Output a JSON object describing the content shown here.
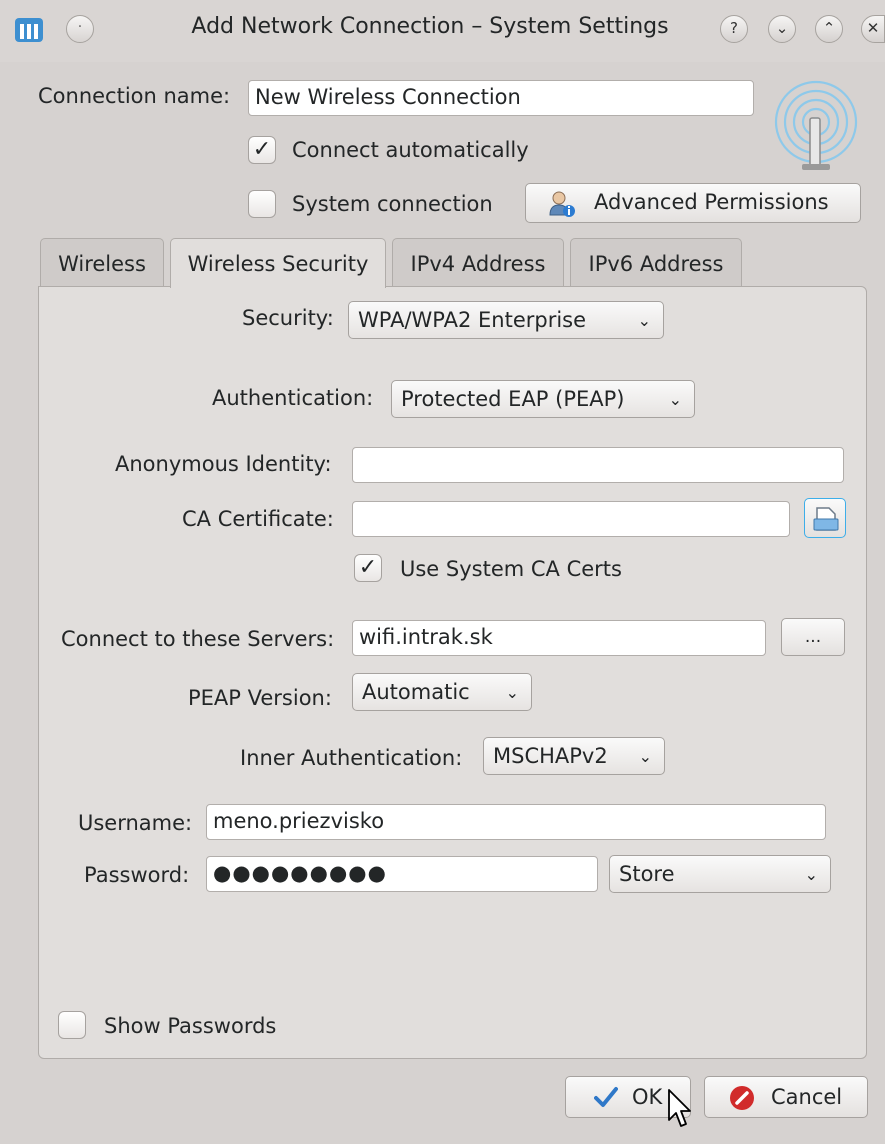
{
  "window": {
    "title": "Add Network Connection – System Settings",
    "controls": [
      "?",
      "⌄",
      "⌃",
      "✕"
    ]
  },
  "connection": {
    "name_label": "Connection name:",
    "name_value": "New Wireless Connection",
    "connect_auto_label": "Connect automatically",
    "connect_auto_checked": true,
    "system_conn_label": "System connection",
    "system_conn_checked": false,
    "advanced_permissions_label": "Advanced Permissions"
  },
  "tabs": [
    {
      "label": "Wireless",
      "active": false
    },
    {
      "label": "Wireless Security",
      "active": true
    },
    {
      "label": "IPv4 Address",
      "active": false
    },
    {
      "label": "IPv6 Address",
      "active": false
    }
  ],
  "security": {
    "security_label": "Security:",
    "security_value": "WPA/WPA2 Enterprise",
    "auth_label": "Authentication:",
    "auth_value": "Protected EAP (PEAP)",
    "anon_identity_label": "Anonymous Identity:",
    "anon_identity_value": "",
    "ca_cert_label": "CA Certificate:",
    "ca_cert_value": "",
    "use_system_ca_label": "Use System CA Certs",
    "use_system_ca_checked": true,
    "servers_label": "Connect to these Servers:",
    "servers_value": "wifi.intrak.sk",
    "servers_button": "...",
    "peap_version_label": "PEAP Version:",
    "peap_version_value": "Automatic",
    "inner_auth_label": "Inner Authentication:",
    "inner_auth_value": "MSCHAPv2",
    "username_label": "Username:",
    "username_value": "meno.priezvisko",
    "password_label": "Password:",
    "password_value": "●●●●●●●●●",
    "password_store_value": "Store",
    "show_passwords_label": "Show Passwords",
    "show_passwords_checked": false
  },
  "footer": {
    "ok_label": "OK",
    "cancel_label": "Cancel"
  },
  "colors": {
    "accent": "#3daee9",
    "cancel_red": "#d12b2b",
    "ok_check_blue": "#2f78c8"
  }
}
